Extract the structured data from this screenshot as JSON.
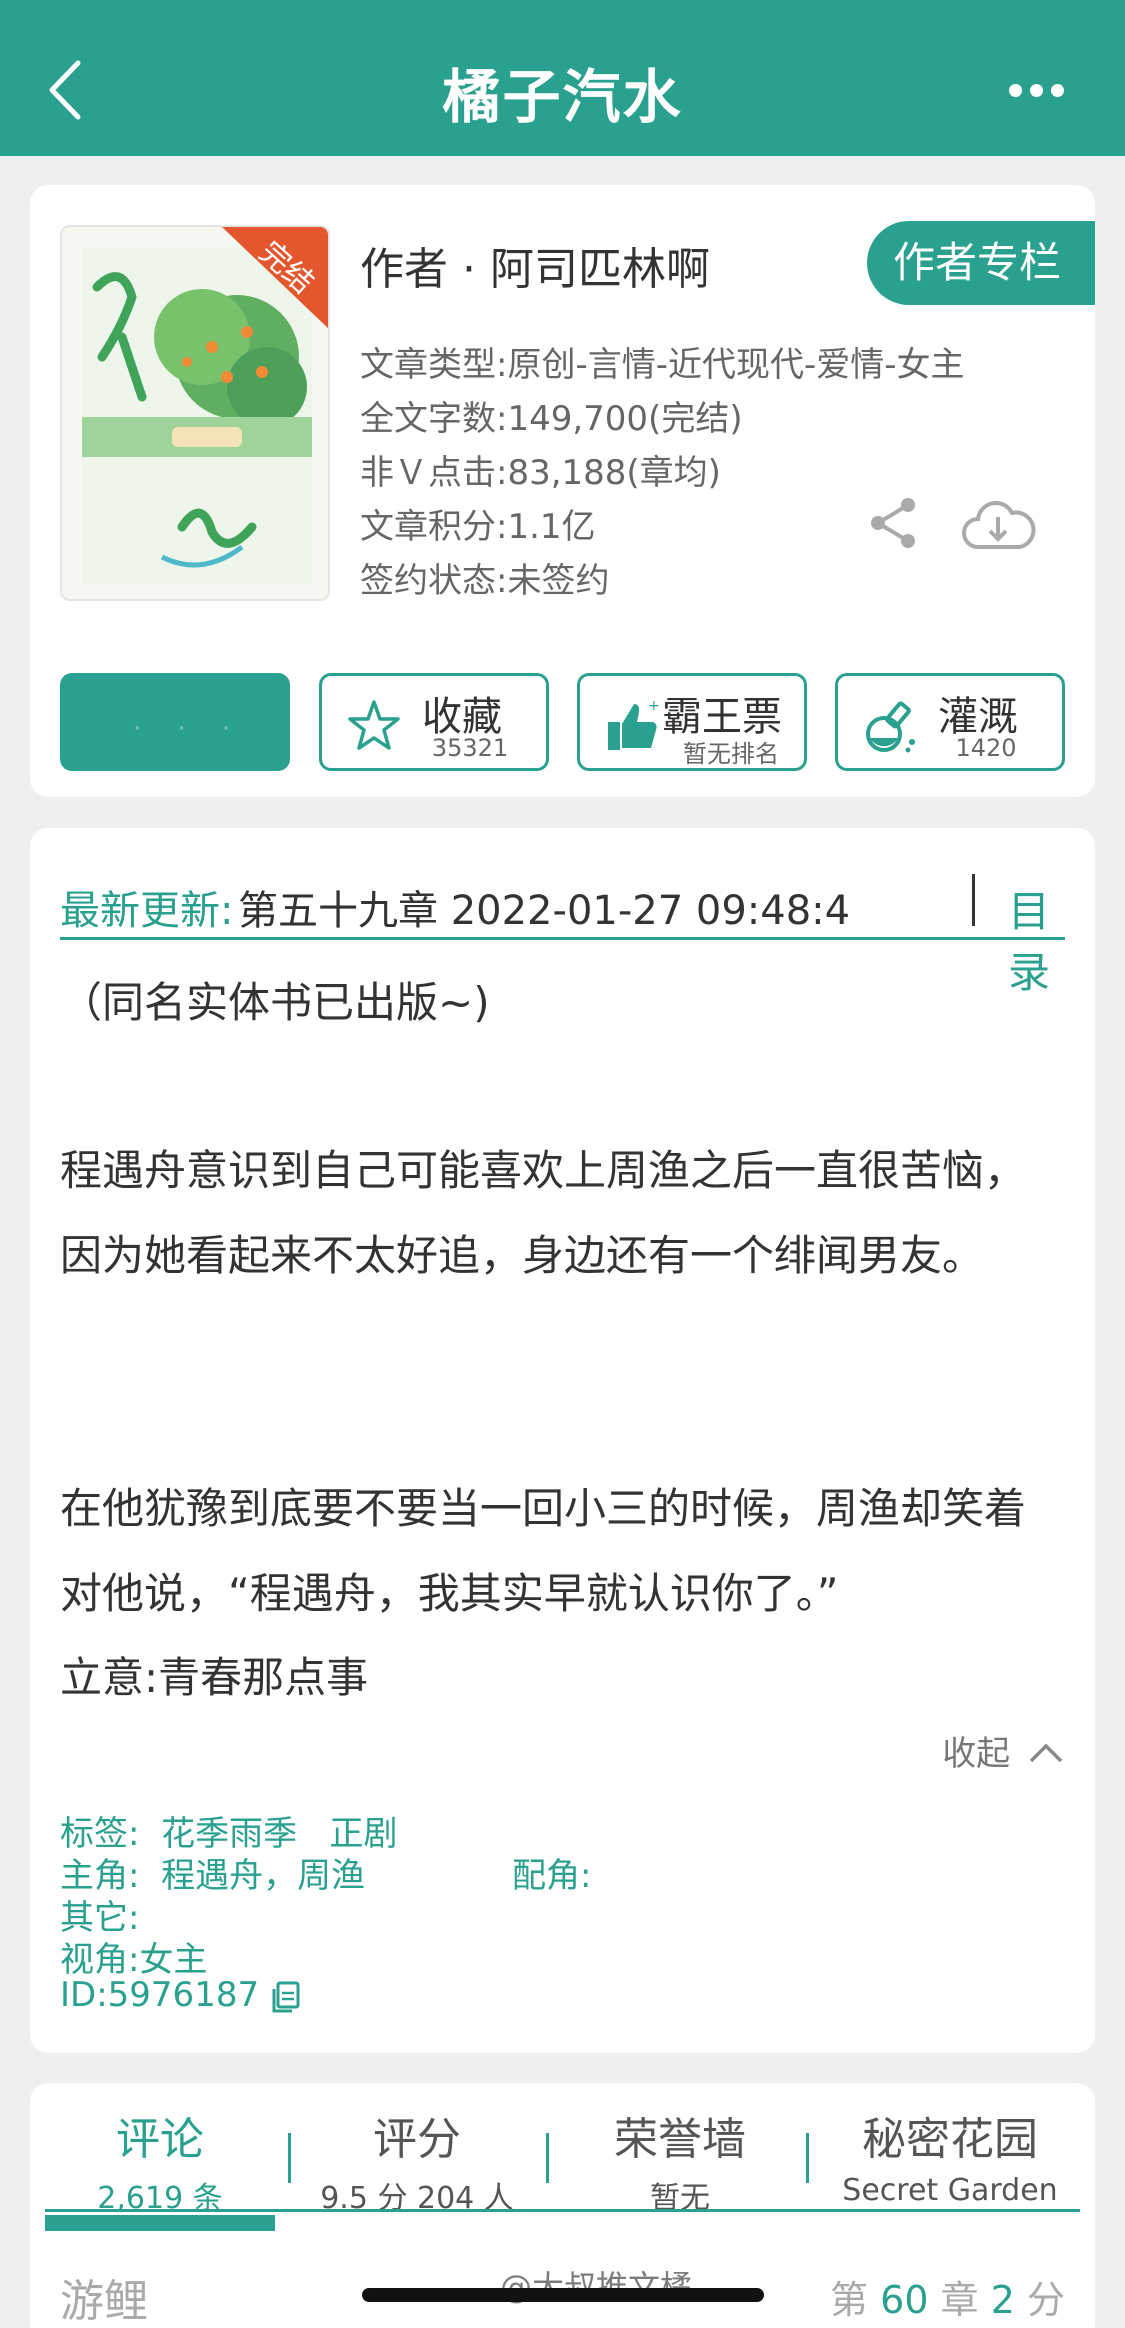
{
  "header": {
    "title": "橘子汽水"
  },
  "book": {
    "badge": "完结",
    "author": "作者 · 阿司匹林啊",
    "author_column_label": "作者专栏",
    "meta": [
      "文章类型:原创-言情-近代现代-爱情-女主",
      "全文字数:149,700(完结)",
      "非Ｖ点击:83,188(章均)",
      "文章积分:1.1亿",
      "签约状态:未签约"
    ],
    "actions": {
      "collect_label": "收藏",
      "collect_count": "35321",
      "ticket_label": "霸王票",
      "ticket_sub": "暂无排名",
      "water_label": "灌溉",
      "water_count": "1420"
    }
  },
  "update": {
    "label": "最新更新:",
    "text": "第五十九章 2022-01-27 09:48:4",
    "toc_label": "目录"
  },
  "intro": {
    "p1": "（同名实体书已出版~)",
    "p2": "程遇舟意识到自己可能喜欢上周渔之后一直很苦恼，因为她看起来不太好追，身边还有一个绯闻男友。",
    "p3": "在他犹豫到底要不要当一回小三的时候，周渔却笑着对他说，“程遇舟，我其实早就认识你了。”",
    "p4": "立意:青春那点事",
    "collapse_label": "收起"
  },
  "tags": {
    "tags_line": "标签:  花季雨季   正剧",
    "lead_line": "主角:  程遇舟，周渔",
    "support_line": "配角:",
    "other_line": "其它:",
    "pov_line": "视角:女主",
    "id_line": "ID:5976187"
  },
  "tabs": [
    {
      "title": "评论",
      "sub": "2,619 条"
    },
    {
      "title": "评分",
      "sub": "9.5 分 204 人"
    },
    {
      "title": "荣誉墙",
      "sub": "暂无"
    },
    {
      "title": "秘密花园",
      "sub": "Secret Garden"
    }
  ],
  "first_comment": {
    "user": "游鲤",
    "chapter_prefix": "第",
    "chapter_num": "60",
    "chapter_suffix": "章",
    "score": "2",
    "score_suffix": "分"
  },
  "watermark": "@大叔推文橘",
  "colors": {
    "accent": "#2aa08e",
    "badge": "#e4572e"
  }
}
